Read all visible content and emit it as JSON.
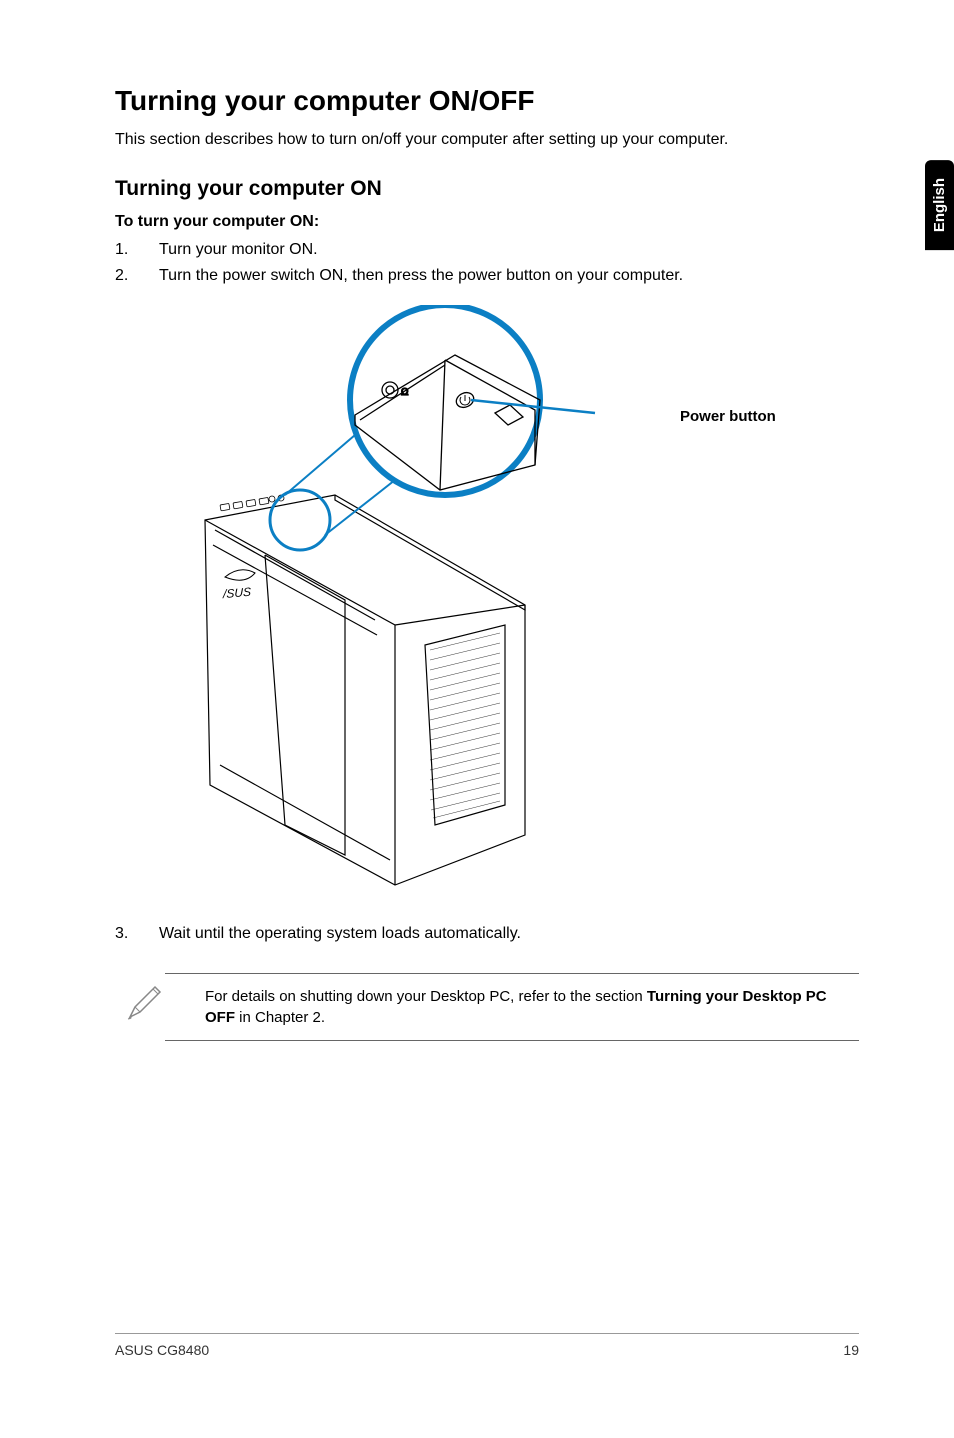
{
  "side_tab": "English",
  "h1": "Turning your computer ON/OFF",
  "intro": "This section describes how to turn on/off your computer after setting up your computer.",
  "h2": "Turning your computer ON",
  "subhead": "To turn your computer ON:",
  "steps": [
    {
      "num": "1.",
      "text": "Turn your monitor ON."
    },
    {
      "num": "2.",
      "text": "Turn the power switch ON, then press the power button on your computer."
    }
  ],
  "power_label": "Power button",
  "step3": {
    "num": "3.",
    "text": "Wait until the operating system loads automatically."
  },
  "note": {
    "prefix": "For details on shutting down your Desktop PC, refer to the section ",
    "bold": "Turning your Desktop PC OFF",
    "suffix": " in Chapter 2."
  },
  "footer": {
    "left": "ASUS CG8480",
    "right": "19"
  }
}
